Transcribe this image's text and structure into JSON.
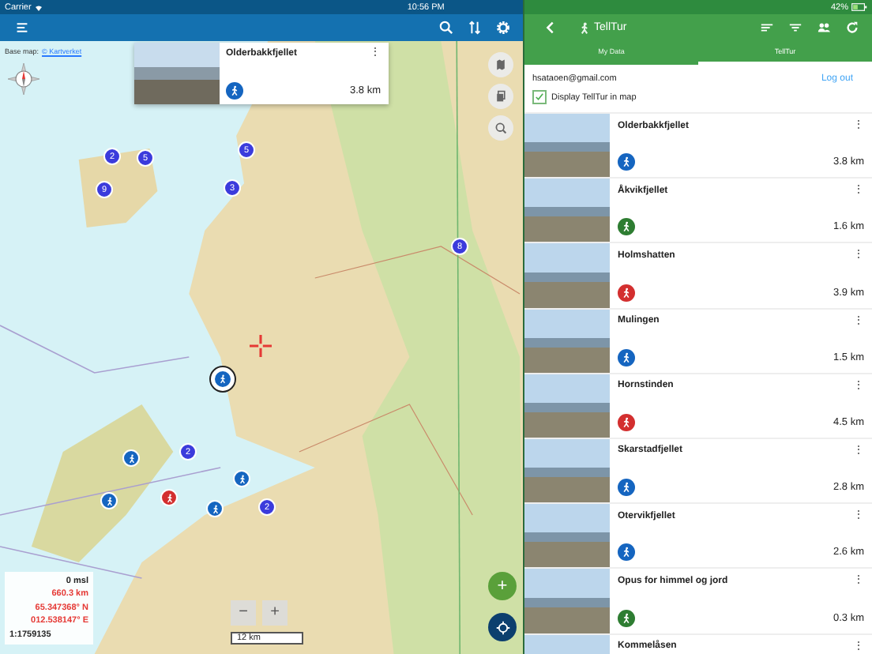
{
  "status_bar": {
    "carrier": "Carrier",
    "time": "10:56 PM",
    "battery": "42%"
  },
  "map": {
    "base_map_label": "Base map:",
    "base_map_link": "© Kartverket",
    "popup": {
      "title": "Olderbakkfjellet",
      "distance": "3.8 km",
      "color": "#1565c0",
      "menu": "⋮"
    },
    "markers": [
      {
        "kind": "cluster",
        "label": "2"
      },
      {
        "kind": "cluster",
        "label": "5"
      },
      {
        "kind": "cluster",
        "label": "9"
      },
      {
        "kind": "cluster",
        "label": "5"
      },
      {
        "kind": "cluster",
        "label": "3"
      },
      {
        "kind": "cluster",
        "label": "8"
      },
      {
        "kind": "cluster",
        "label": "2"
      },
      {
        "kind": "cluster",
        "label": "2"
      },
      {
        "kind": "trail",
        "color": "#1565c0"
      },
      {
        "kind": "trail",
        "color": "#1565c0"
      },
      {
        "kind": "trail",
        "color": "#1565c0"
      },
      {
        "kind": "trail",
        "color": "#1565c0"
      },
      {
        "kind": "trail",
        "color": "#d32f2f"
      },
      {
        "kind": "selected",
        "color": "#1565c0"
      }
    ],
    "info": [
      {
        "text": "0 msl",
        "color": "#222222"
      },
      {
        "text": "660.3  km",
        "color": "#e53935"
      },
      {
        "text": "65.347368° N",
        "color": "#e53935"
      },
      {
        "text": "012.538147° E",
        "color": "#e53935"
      },
      {
        "text": "1:1759135",
        "color": "#222222"
      }
    ],
    "zoom_out": "−",
    "zoom_in": "+",
    "scale": "12 km",
    "fab": "+"
  },
  "panel": {
    "title": "TellTur",
    "tabs": [
      {
        "label": "My Data",
        "selected": false
      },
      {
        "label": "TellTur",
        "selected": true
      }
    ],
    "email": "hsataoen@gmail.com",
    "logout": "Log out",
    "display_in_map": {
      "label": "Display TellTur in map",
      "checked": true
    },
    "items": [
      {
        "name": "Olderbakkfjellet",
        "distance": "3.8 km",
        "color": "#1565c0"
      },
      {
        "name": "Åkvikfjellet",
        "distance": "1.6 km",
        "color": "#2e7d32"
      },
      {
        "name": "Holmshatten",
        "distance": "3.9 km",
        "color": "#d32f2f"
      },
      {
        "name": "Mulingen",
        "distance": "1.5 km",
        "color": "#1565c0"
      },
      {
        "name": "Hornstinden",
        "distance": "4.5 km",
        "color": "#d32f2f"
      },
      {
        "name": "Skarstadfjellet",
        "distance": "2.8 km",
        "color": "#1565c0"
      },
      {
        "name": "Otervikfjellet",
        "distance": "2.6 km",
        "color": "#1565c0"
      },
      {
        "name": "Opus for himmel og jord",
        "distance": "0.3 km",
        "color": "#2e7d32"
      },
      {
        "name": "Kommelåsen"
      }
    ],
    "menu": "⋮"
  }
}
